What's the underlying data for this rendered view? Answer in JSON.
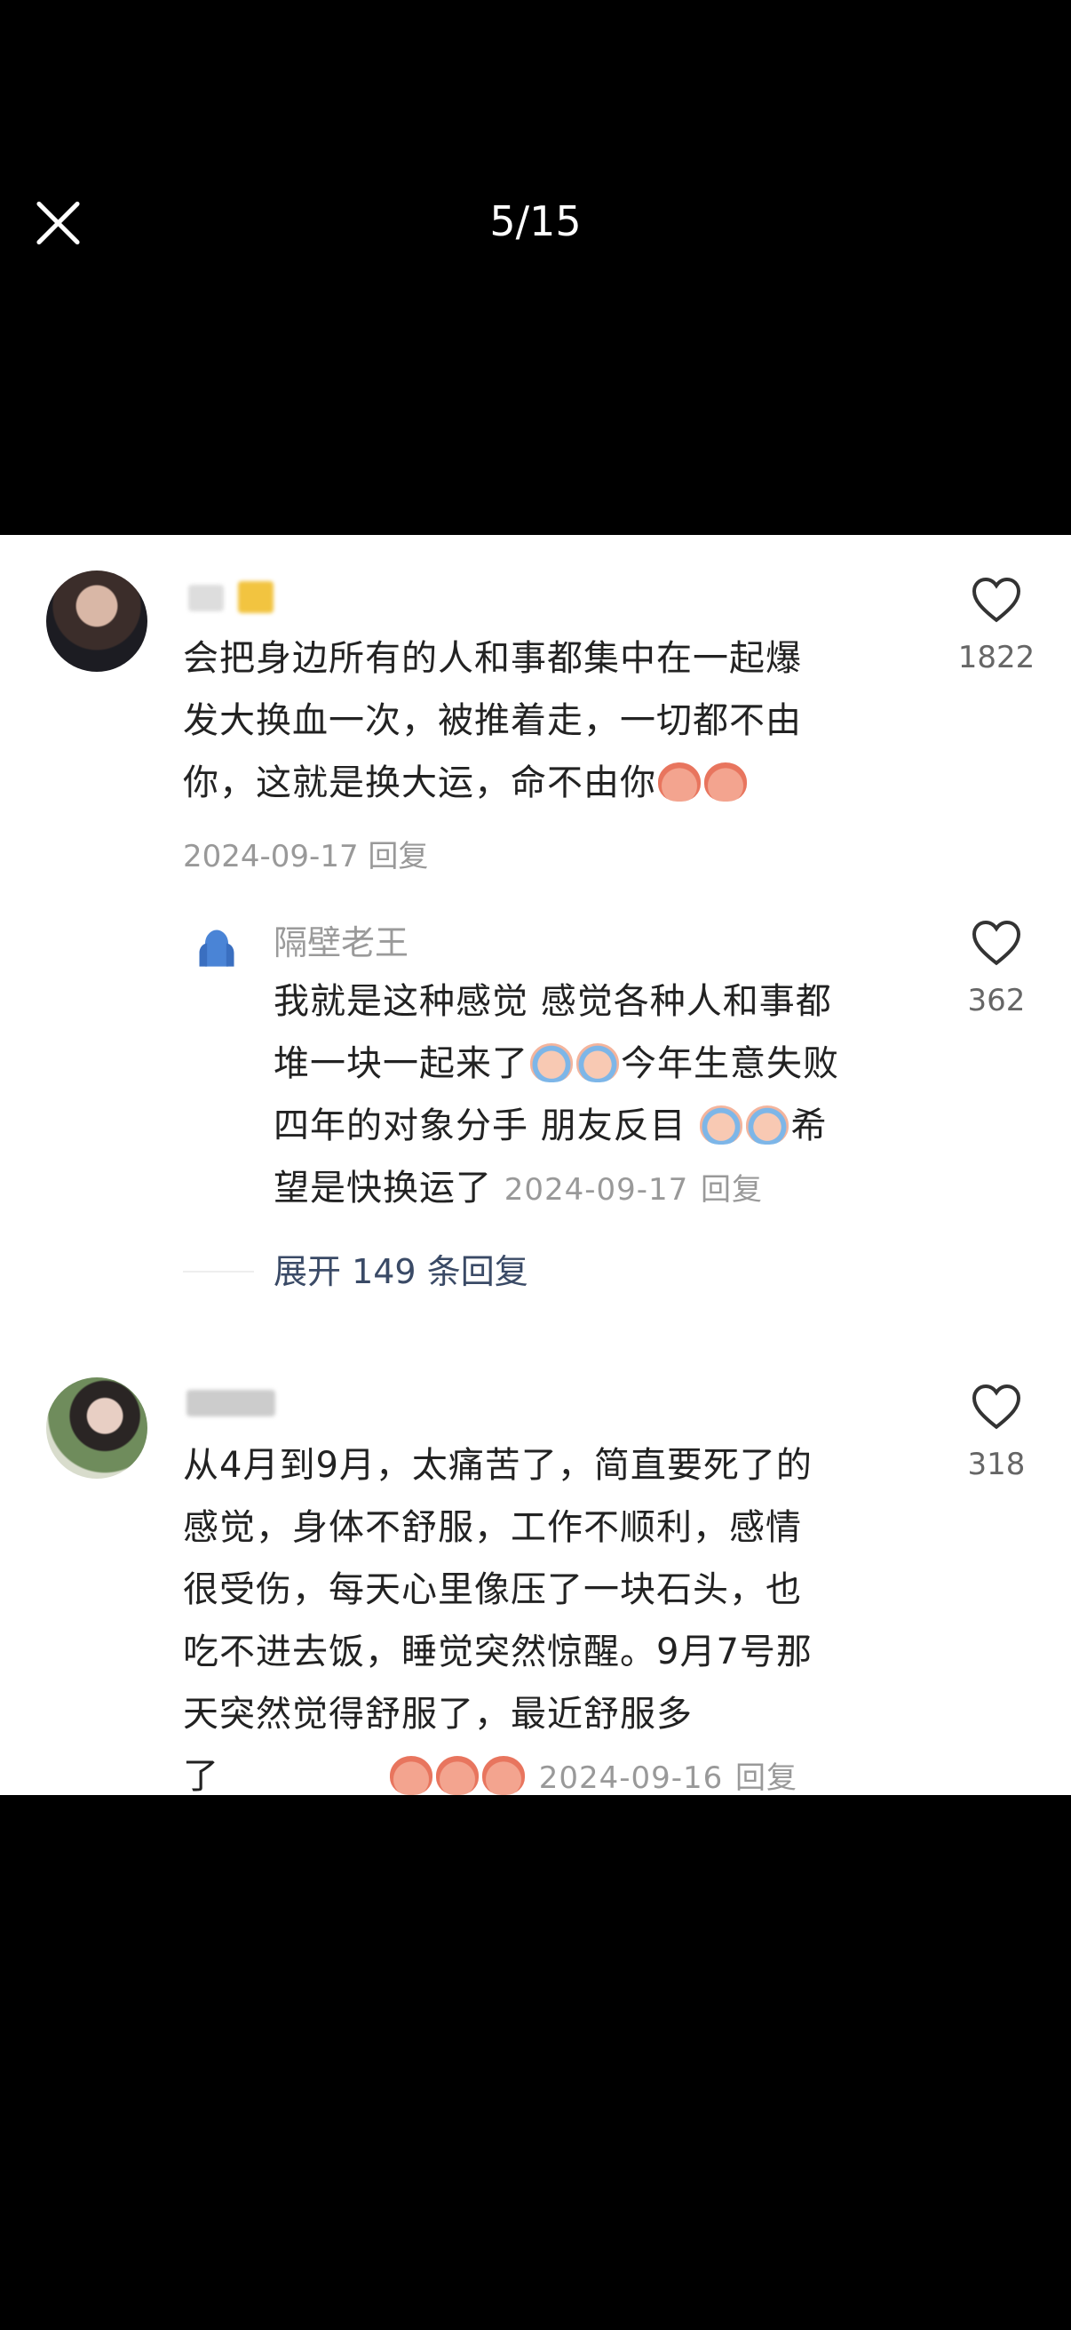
{
  "viewer": {
    "counter": "5/15"
  },
  "comments": [
    {
      "text_line1": "会把身边所有的人和事都集中在一起爆",
      "text_line2": "发大换血一次，被推着走，一切都不由",
      "text_line3": "你，这就是换大运，命不由你",
      "date": "2024-09-17",
      "reply_label": "回复",
      "likes": "1822"
    },
    {
      "author": "隔壁老王",
      "text_line1": "我就是这种感觉 感觉各种人和事都",
      "text_line2a": "堆一块一起来了",
      "text_line2b": "今年生意失败",
      "text_line3a": "四年的对象分手 朋友反目",
      "text_line3b": "希",
      "text_line4": "望是快换运了",
      "date": "2024-09-17",
      "reply_label": "回复",
      "likes": "362",
      "expand": "展开 149 条回复"
    },
    {
      "text_line1": "从4月到9月，太痛苦了，简直要死了的",
      "text_line2": "感觉，身体不舒服，工作不顺利，感情",
      "text_line3": "很受伤，每天心里像压了一块石头，也",
      "text_line4": "吃不进去饭，睡觉突然惊醒。9月7号那",
      "text_line5": "天突然觉得舒服了，最近舒服多",
      "text_line6": "了",
      "date": "2024-09-16",
      "reply_label": "回复",
      "likes": "318"
    }
  ],
  "colors": {
    "heart": "#333333",
    "meta": "#999999",
    "expand": "#3a4a66"
  }
}
